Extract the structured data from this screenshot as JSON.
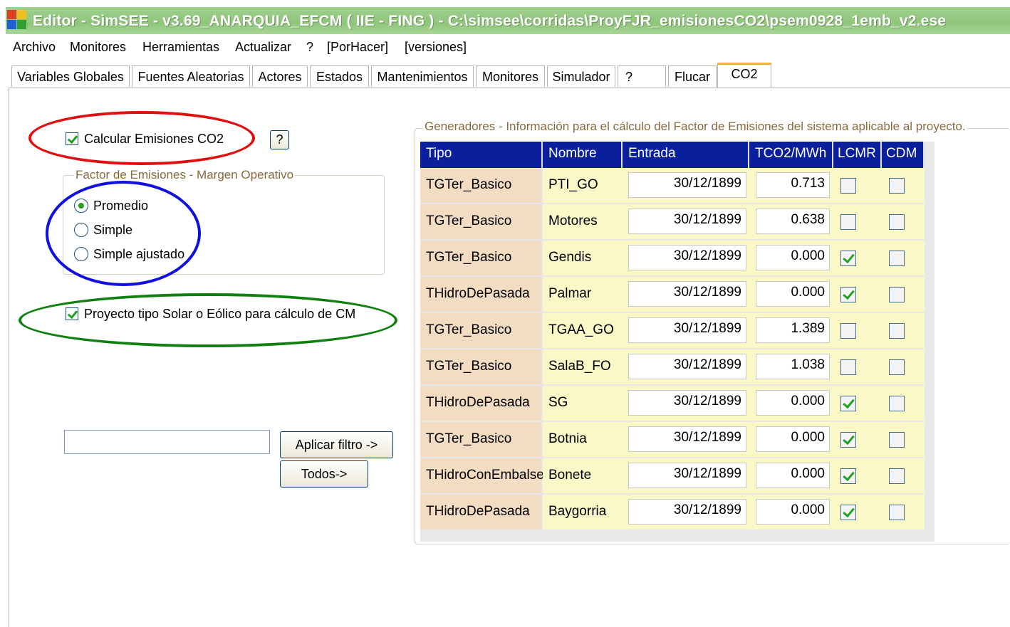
{
  "window": {
    "title": "Editor - SimSEE - v3.69_ANARQUIA_EFCM ( IIE - FING ) - C:\\simsee\\corridas\\ProyFJR_emisionesCO2\\psem0928_1emb_v2.ese"
  },
  "menu": [
    "Archivo",
    "Monitores",
    "Herramientas",
    "Actualizar",
    "?",
    "[PorHacer]",
    "[versiones]"
  ],
  "tabs": [
    "Variables Globales",
    "Fuentes Aleatorias",
    "Actores",
    "Estados",
    "Mantenimientos",
    "Monitores",
    "Simulador",
    "?",
    "Flucar",
    "CO2"
  ],
  "active_tab": "CO2",
  "left_panel": {
    "calc_co2_label": "Calcular Emisiones CO2",
    "calc_co2_checked": true,
    "help_label": "?",
    "factor_group_title": "Factor de Emisiones - Margen Operativo",
    "radio_options": [
      "Promedio",
      "Simple",
      "Simple ajustado"
    ],
    "radio_selected": "Promedio",
    "proyecto_label": "Proyecto tipo Solar o Eólico para cálculo de CM",
    "proyecto_checked": true,
    "filter_value": "",
    "apply_filter_label": "Aplicar filtro ->",
    "all_label": "Todos->"
  },
  "generators": {
    "group_title": "Generadores - Información para el cálculo del Factor de Emisiones del sistema aplicable al proyecto.",
    "columns": [
      "Tipo",
      "Nombre",
      "Entrada",
      "TCO2/MWh",
      "LCMR",
      "CDM"
    ],
    "rows": [
      {
        "tipo": "TGTer_Basico",
        "nombre": "PTI_GO",
        "entrada": "30/12/1899",
        "tco2": "0.713",
        "lcmr": false,
        "cdm": false
      },
      {
        "tipo": "TGTer_Basico",
        "nombre": "Motores",
        "entrada": "30/12/1899",
        "tco2": "0.638",
        "lcmr": false,
        "cdm": false
      },
      {
        "tipo": "TGTer_Basico",
        "nombre": "Gendis",
        "entrada": "30/12/1899",
        "tco2": "0.000",
        "lcmr": true,
        "cdm": false
      },
      {
        "tipo": "THidroDePasada",
        "nombre": "Palmar",
        "entrada": "30/12/1899",
        "tco2": "0.000",
        "lcmr": true,
        "cdm": false
      },
      {
        "tipo": "TGTer_Basico",
        "nombre": "TGAA_GO",
        "entrada": "30/12/1899",
        "tco2": "1.389",
        "lcmr": false,
        "cdm": false
      },
      {
        "tipo": "TGTer_Basico",
        "nombre": "SalaB_FO",
        "entrada": "30/12/1899",
        "tco2": "1.038",
        "lcmr": false,
        "cdm": false
      },
      {
        "tipo": "THidroDePasada",
        "nombre": "SG",
        "entrada": "30/12/1899",
        "tco2": "0.000",
        "lcmr": true,
        "cdm": false
      },
      {
        "tipo": "TGTer_Basico",
        "nombre": "Botnia",
        "entrada": "30/12/1899",
        "tco2": "0.000",
        "lcmr": true,
        "cdm": false
      },
      {
        "tipo": "THidroConEmbalse",
        "nombre": "Bonete",
        "entrada": "30/12/1899",
        "tco2": "0.000",
        "lcmr": true,
        "cdm": false
      },
      {
        "tipo": "THidroDePasada",
        "nombre": "Baygorria",
        "entrada": "30/12/1899",
        "tco2": "0.000",
        "lcmr": true,
        "cdm": false
      }
    ]
  },
  "colors": {
    "header_bg": "#0a1f9c",
    "tipo_bg": "#f2dcc2",
    "row_bg": "#fbf8c8",
    "highlight_red": "#e01010",
    "highlight_blue": "#1010e0",
    "highlight_green": "#108010"
  }
}
